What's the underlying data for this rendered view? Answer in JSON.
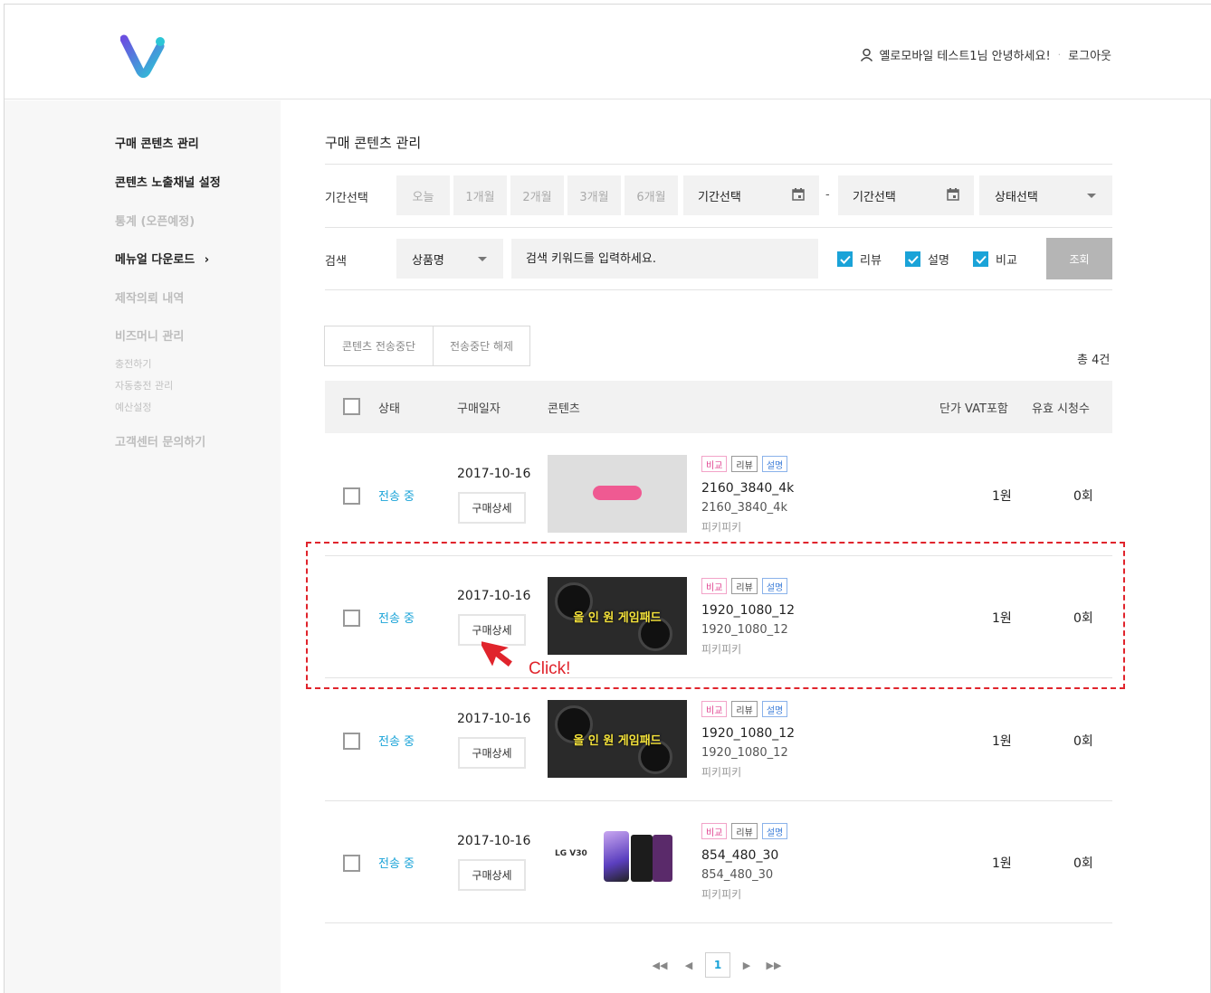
{
  "header": {
    "greeting": "옐로모바일 테스트1님 안녕하세요!",
    "logout": "로그아웃",
    "brand_color": "#5a4fd8"
  },
  "sidebar": {
    "items": [
      {
        "label": "구매 콘텐츠 관리",
        "state": "active"
      },
      {
        "label": "콘텐츠 노출채널 설정",
        "state": "active"
      },
      {
        "label": "통계 (오픈예정)",
        "state": "disabled"
      },
      {
        "label": "메뉴얼 다운로드",
        "state": "active",
        "arrow": "›"
      },
      {
        "label": "제작의뢰 내역",
        "state": "disabled"
      },
      {
        "label": "비즈머니 관리",
        "state": "disabled"
      },
      {
        "label": "충전하기",
        "state": "sub"
      },
      {
        "label": "자동충전 관리",
        "state": "sub"
      },
      {
        "label": "예산설정",
        "state": "sub"
      },
      {
        "label": "고객센터 문의하기",
        "state": "disabled"
      }
    ]
  },
  "main": {
    "title": "구매 콘텐츠 관리",
    "filter": {
      "period_label": "기간선택",
      "periods": [
        "오늘",
        "1개월",
        "2개월",
        "3개월",
        "6개월"
      ],
      "date_from": "기간선택",
      "date_sep": "-",
      "date_to": "기간선택",
      "status_select": "상태선택",
      "search_label": "검색",
      "search_type": "상품명",
      "search_placeholder": "검색 키워드를 입력하세요.",
      "checks": [
        "리뷰",
        "설명",
        "비교"
      ],
      "search_button": "조회"
    },
    "actions": {
      "stop": "콘텐츠 전송중단",
      "resume": "전송중단 해제"
    },
    "total": "총 4건",
    "table": {
      "headers": [
        "상태",
        "구매일자",
        "콘텐츠",
        "단가 VAT포함",
        "유효 시청수"
      ],
      "detail_label": "구매상세",
      "tag_labels": [
        "비교",
        "리뷰",
        "설명"
      ],
      "rows": [
        {
          "status": "전송 중",
          "date": "2017-10-16",
          "title": "2160_3840_4k",
          "sub": "2160_3840_4k",
          "seller": "피키피키",
          "price": "1원",
          "views": "0회",
          "thumb": "pink-badge"
        },
        {
          "status": "전송 중",
          "date": "2017-10-16",
          "title": "1920_1080_12",
          "sub": "1920_1080_12",
          "seller": "피키피키",
          "price": "1원",
          "views": "0회",
          "thumb": "gamepad",
          "thumb_text": "올 인 원 게임패드"
        },
        {
          "status": "전송 중",
          "date": "2017-10-16",
          "title": "1920_1080_12",
          "sub": "1920_1080_12",
          "seller": "피키피키",
          "price": "1원",
          "views": "0회",
          "thumb": "gamepad",
          "thumb_text": "올 인 원 게임패드"
        },
        {
          "status": "전송 중",
          "date": "2017-10-16",
          "title": "854_480_30",
          "sub": "854_480_30",
          "seller": "피키피키",
          "price": "1원",
          "views": "0회",
          "thumb": "phones",
          "thumb_text": "LG V30"
        }
      ]
    },
    "annotation": "Click!",
    "pager": {
      "current": "1"
    }
  }
}
